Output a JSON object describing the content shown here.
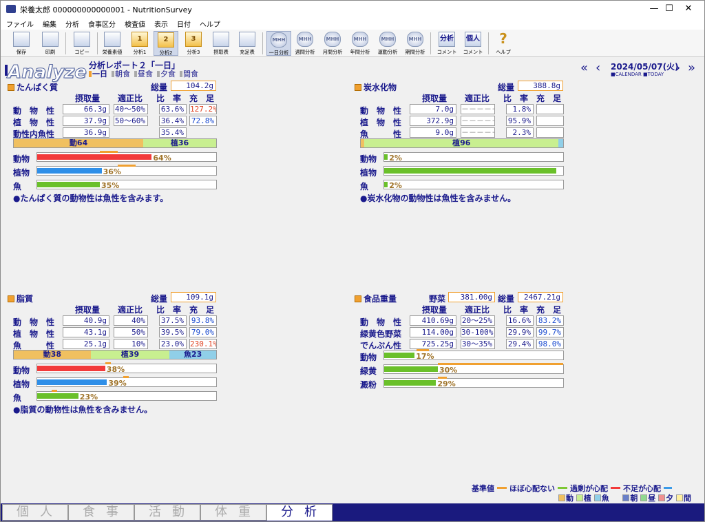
{
  "window": {
    "title": "栄養太郎 000000000000001 - NutritionSurvey",
    "minimize": "—",
    "maximize": "☐",
    "close": "✕"
  },
  "menu": [
    "ファイル",
    "編集",
    "分析",
    "食事区分",
    "検査値",
    "表示",
    "日付",
    "ヘルプ"
  ],
  "toolbar": [
    "保存",
    "印刷",
    "コピー",
    "栄養素値",
    "分析1",
    "分析2",
    "分析3",
    "摂取表",
    "充足表",
    "一日分析",
    "週間分析",
    "月間分析",
    "年間分析",
    "運動分析",
    "期間分析",
    "コメント",
    "コメント",
    "ヘルプ"
  ],
  "toolbar_icons": {
    "numbers": [
      "1",
      "2",
      "3"
    ],
    "mhh": "MHH",
    "bunseki": "分析",
    "kojin": "個人",
    "help": "?"
  },
  "logo": "Analyze",
  "report": {
    "title": "分析レポート２「一日」",
    "meals": [
      "一日",
      "朝食",
      "昼食",
      "夕食",
      "間食"
    ]
  },
  "date": {
    "text": "2024/05/07(火)",
    "links": "■CALENDAR ■TODAY",
    "nav": [
      "«",
      "‹",
      "›",
      "»"
    ]
  },
  "headers": {
    "intake": "摂取量",
    "ratio": "適正比",
    "rate": "比　率",
    "fill": "充　足",
    "total": "総量"
  },
  "protein": {
    "title": "たんぱく質",
    "total": "104.2g",
    "rows": [
      {
        "label": "動　物　性",
        "intake": "66.3g",
        "proper": "40〜50%",
        "rate": "63.6%",
        "fill": "127.2%"
      },
      {
        "label": "植　物　性",
        "intake": "37.9g",
        "proper": "50〜60%",
        "rate": "36.4%",
        "fill": "72.8%"
      },
      {
        "label": "動性内魚性",
        "intake": "36.9g",
        "proper": "",
        "rate": "35.4%",
        "fill": ""
      }
    ],
    "stack": [
      "動64",
      "植36"
    ],
    "stack_values": [
      64,
      36
    ],
    "bars": [
      {
        "label": "動物",
        "pct": "64%",
        "value": 64,
        "ref": [
          35,
          45
        ]
      },
      {
        "label": "植物",
        "pct": "36%",
        "value": 36,
        "ref": [
          45,
          55
        ]
      },
      {
        "label": "魚",
        "pct": "35%",
        "value": 35
      }
    ],
    "note": "●たんぱく質の動物性は魚性を含みます。"
  },
  "carb": {
    "title": "炭水化物",
    "total": "388.8g",
    "rows": [
      {
        "label": "動　物　性",
        "intake": "7.0g",
        "proper": "－－－－－－",
        "rate": "1.8%",
        "fill": ""
      },
      {
        "label": "植　物　性",
        "intake": "372.9g",
        "proper": "－－－－－－",
        "rate": "95.9%",
        "fill": ""
      },
      {
        "label": "魚　　　性",
        "intake": "9.0g",
        "proper": "－－－－－－",
        "rate": "2.3%",
        "fill": ""
      }
    ],
    "stack": [
      "",
      "植96",
      ""
    ],
    "stack_values": [
      1.8,
      95.9,
      2.3
    ],
    "bars": [
      {
        "label": "動物",
        "pct": "2%",
        "value": 2
      },
      {
        "label": "植物",
        "pct": "",
        "value": 96
      },
      {
        "label": "魚",
        "pct": "2%",
        "value": 2
      }
    ],
    "note": "●炭水化物の動物性は魚性を含みません。"
  },
  "fat": {
    "title": "脂質",
    "total": "109.1g",
    "rows": [
      {
        "label": "動　物　性",
        "intake": "40.9g",
        "proper": "40%",
        "rate": "37.5%",
        "fill": "93.8%"
      },
      {
        "label": "植　物　性",
        "intake": "43.1g",
        "proper": "50%",
        "rate": "39.5%",
        "fill": "79.0%"
      },
      {
        "label": "魚　　　性",
        "intake": "25.1g",
        "proper": "10%",
        "rate": "23.0%",
        "fill": "230.1%"
      }
    ],
    "stack": [
      "動38",
      "植39",
      "魚23"
    ],
    "stack_values": [
      38,
      39,
      23
    ],
    "bars": [
      {
        "label": "動物",
        "pct": "38%",
        "value": 38,
        "ref": [
          38,
          41
        ]
      },
      {
        "label": "植物",
        "pct": "39%",
        "value": 39,
        "ref": [
          48,
          51
        ]
      },
      {
        "label": "魚",
        "pct": "23%",
        "value": 23,
        "ref": [
          8,
          11
        ]
      }
    ],
    "note": "●脂質の動物性は魚性を含みません。"
  },
  "food": {
    "title": "食品重量",
    "veg_label": "野菜",
    "veg_total": "381.00g",
    "total": "2467.21g",
    "rows": [
      {
        "label": "動　物　性",
        "intake": "410.69g",
        "proper": "20〜25%",
        "rate": "16.6%",
        "fill": "83.2%"
      },
      {
        "label": "緑黄色野菜",
        "intake": "114.00g",
        "proper": "30-100%",
        "rate": "29.9%",
        "fill": "99.7%"
      },
      {
        "label": "でんぷん性",
        "intake": "725.25g",
        "proper": "30〜35%",
        "rate": "29.4%",
        "fill": "98.0%"
      }
    ],
    "bars": [
      {
        "label": "動物",
        "pct": "17%",
        "value": 17,
        "ref": [
          18,
          25
        ]
      },
      {
        "label": "緑黄",
        "pct": "30%",
        "value": 30,
        "ref": [
          30,
          100
        ]
      },
      {
        "label": "澱粉",
        "pct": "29%",
        "value": 29,
        "ref": [
          30,
          35
        ]
      }
    ]
  },
  "legend": {
    "base": "基準値",
    "ok": "ほぼ心配ない",
    "over": "過剰が心配",
    "under": "不足が心配",
    "meals": [
      "動",
      "植",
      "魚",
      "朝",
      "昼",
      "夕",
      "間"
    ]
  },
  "colors": {
    "animal": "#f23a3a",
    "plant": "#2f8fe8",
    "fish": "#6ac02a",
    "ok": "#f0a030",
    "over": "#7ec834",
    "under": "#f23a3a",
    "under2": "#3a9ae8"
  },
  "tabs": [
    "個人",
    "食事",
    "活動",
    "体重",
    "分析"
  ]
}
